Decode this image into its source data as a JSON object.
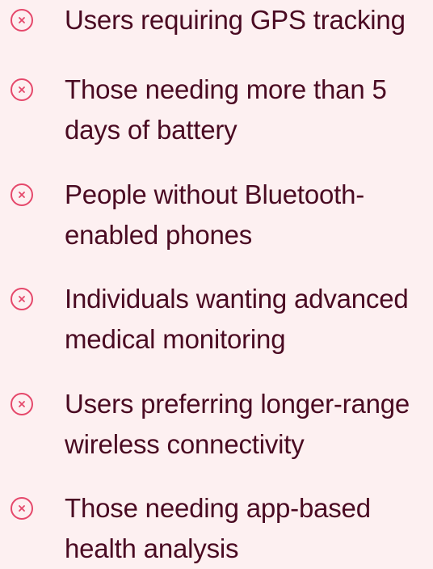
{
  "accent_color": "#e5486b",
  "text_color": "#4a0a22",
  "background_color": "#fdf0f1",
  "items": [
    {
      "icon": "x-circle-icon",
      "label": "Users requiring GPS tracking"
    },
    {
      "icon": "x-circle-icon",
      "label": "Those needing more than 5\ndays of battery"
    },
    {
      "icon": "x-circle-icon",
      "label": "People without Bluetooth-\nenabled phones"
    },
    {
      "icon": "x-circle-icon",
      "label": "Individuals wanting advanced\nmedical monitoring"
    },
    {
      "icon": "x-circle-icon",
      "label": "Users preferring longer-range\nwireless connectivity"
    },
    {
      "icon": "x-circle-icon",
      "label": "Those needing app-based\nhealth analysis"
    }
  ]
}
